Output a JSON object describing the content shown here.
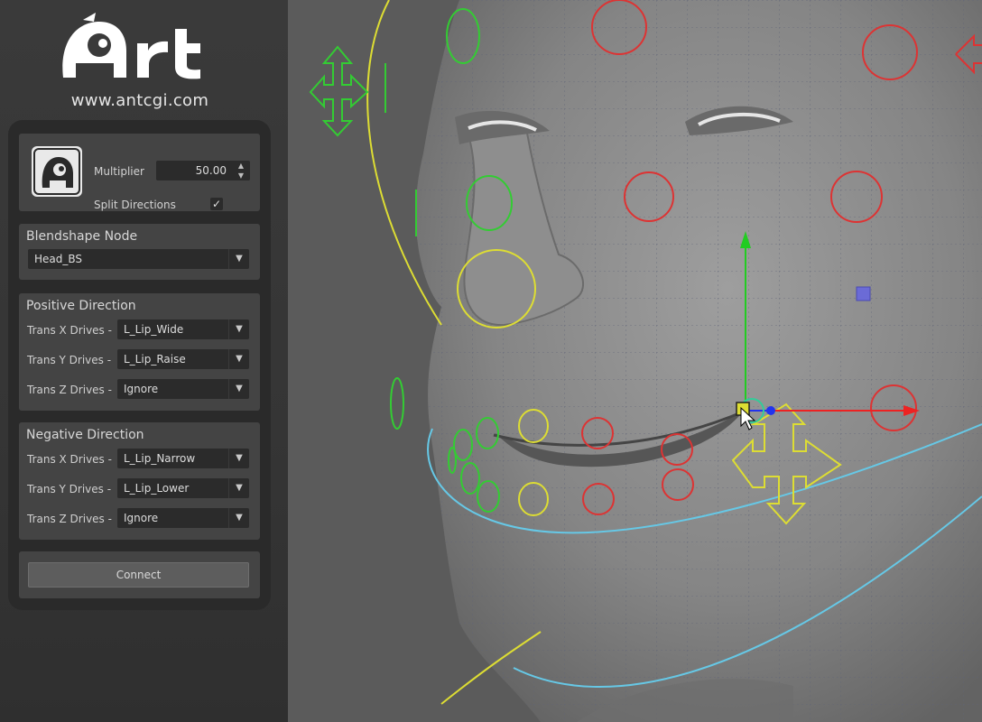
{
  "brand": {
    "logo_text": "Art",
    "url": "www.antcgi.com"
  },
  "tool": {
    "multiplier": {
      "label": "Multiplier",
      "value": "50.00"
    },
    "split_directions": {
      "label": "Split Directions",
      "checked": true
    },
    "blendshape": {
      "title": "Blendshape Node",
      "value": "Head_BS"
    },
    "positive": {
      "title": "Positive Direction",
      "rows": [
        {
          "label": "Trans X Drives -",
          "value": "L_Lip_Wide"
        },
        {
          "label": "Trans Y Drives -",
          "value": "L_Lip_Raise"
        },
        {
          "label": "Trans Z Drives -",
          "value": "Ignore"
        }
      ]
    },
    "negative": {
      "title": "Negative Direction",
      "rows": [
        {
          "label": "Trans X Drives -",
          "value": "L_Lip_Narrow"
        },
        {
          "label": "Trans Y Drives -",
          "value": "L_Lip_Lower"
        },
        {
          "label": "Trans Z Drives -",
          "value": "Ignore"
        }
      ]
    },
    "connect_label": "Connect"
  },
  "icons": {
    "checkmark": "✓",
    "dropdown": "▼",
    "spin_up": "▲",
    "spin_down": "▼"
  },
  "colors": {
    "control_left": "#33cc33",
    "control_right": "#dd3333",
    "control_center": "#dddd33",
    "jaw_curve": "#66c8e6",
    "axis_x": "#ee2222",
    "axis_y": "#22cc22",
    "axis_z": "#2233ee"
  }
}
